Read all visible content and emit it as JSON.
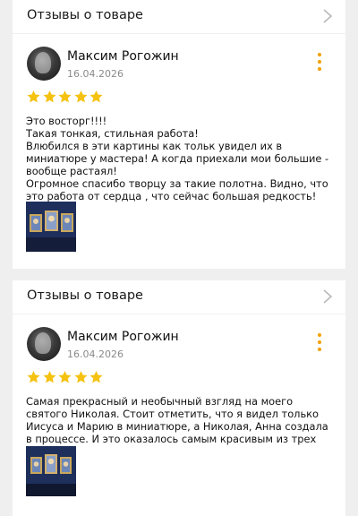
{
  "reviews": [
    {
      "header": "Отзывы о товаре",
      "author": "Максим Рогожин",
      "date": "16.04.2026",
      "rating": 5,
      "text": "Это восторг!!!!\nТакая тонкая, стильная работа!\nВлюбился в эти картины как тольк увидел их в миниатюре у мастера! А когда приехали мои большие - вообще растаял!\nОгромное спасибо творцу за такие полотна. Видно, что это работа от сердца , что сейчас большая редкость!"
    },
    {
      "header": "Отзывы о товаре",
      "author": "Максим Рогожин",
      "date": "16.04.2026",
      "rating": 5,
      "text": "Самая прекрасный и необычный взгляд на моего святого Николая. Стоит отметить, что я видел только Иисуса и Марию в миниатюре, а Николая, Анна создала в процессе. И это оказалось самым красивым из трех полотен."
    }
  ],
  "colors": {
    "star": "#f5c211",
    "menu_dots": "#f2a100",
    "page_background": "#efefef"
  },
  "icons": {
    "header_arrow": "chevron-right-icon",
    "menu": "more-vertical-icon",
    "rating": "star-icon"
  }
}
